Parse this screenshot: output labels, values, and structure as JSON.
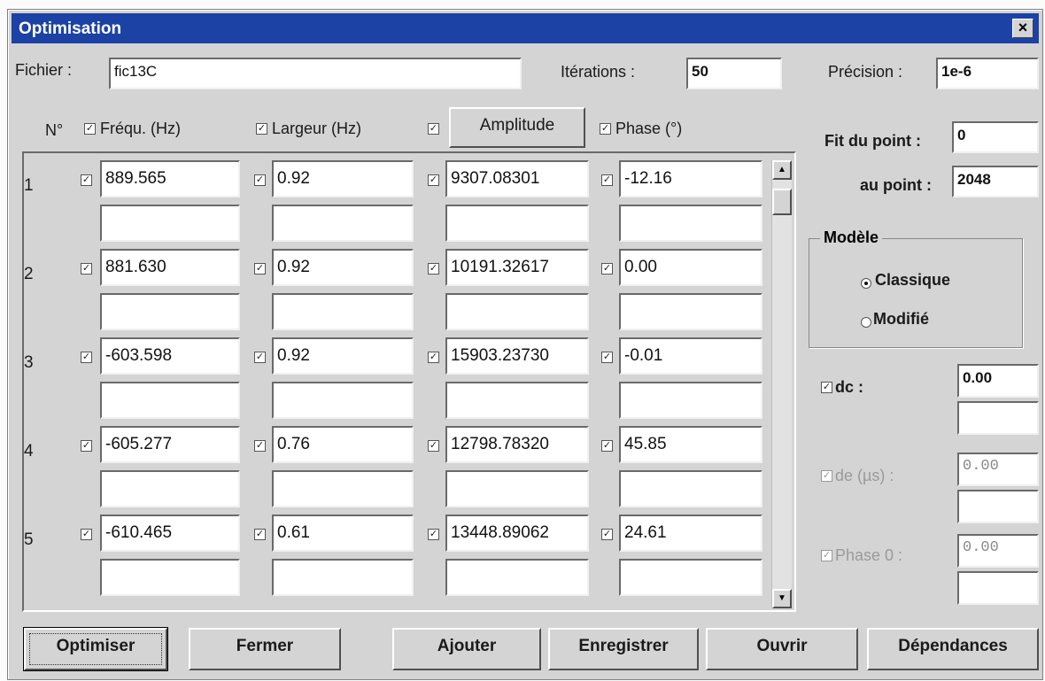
{
  "window": {
    "title": "Optimisation",
    "close_glyph": "×"
  },
  "fichier": {
    "label": "Fichier :",
    "value": "fic13C"
  },
  "iterations": {
    "label": "Itérations :",
    "value": "50"
  },
  "precision": {
    "label": "Précision :",
    "value": "1e-6"
  },
  "columns": {
    "num": "N°",
    "freq": "Fréqu. (Hz)",
    "largeur": "Largeur (Hz)",
    "amplitude_button": "Amplitude",
    "phase": "Phase (°)"
  },
  "check_glyph": "✓",
  "rows": [
    {
      "n": "1",
      "freq": "889.565",
      "largeur": "0.92",
      "amplitude": "9307.08301",
      "phase": "-12.16"
    },
    {
      "n": "2",
      "freq": "881.630",
      "largeur": "0.92",
      "amplitude": "10191.32617",
      "phase": "0.00"
    },
    {
      "n": "3",
      "freq": "-603.598",
      "largeur": "0.92",
      "amplitude": "15903.23730",
      "phase": "-0.01"
    },
    {
      "n": "4",
      "freq": "-605.277",
      "largeur": "0.76",
      "amplitude": "12798.78320",
      "phase": "45.85"
    },
    {
      "n": "5",
      "freq": "-610.465",
      "largeur": "0.61",
      "amplitude": "13448.89062",
      "phase": "24.61"
    }
  ],
  "fit": {
    "from_label": "Fit du point :",
    "from_value": "0",
    "to_label": "au point :",
    "to_value": "2048"
  },
  "modele": {
    "legend": "Modèle",
    "option1": "Classique",
    "option2": "Modifié",
    "selected": "Classique"
  },
  "dc": {
    "label": "dc :",
    "value": "0.00"
  },
  "de": {
    "label": "de (µs) :",
    "value": "0.00"
  },
  "phase0": {
    "label": "Phase 0 :",
    "value": "0.00"
  },
  "buttons": {
    "optimiser": "Optimiser",
    "fermer": "Fermer",
    "ajouter": "Ajouter",
    "enregistrer": "Enregistrer",
    "ouvrir": "Ouvrir",
    "dependances": "Dépendances"
  }
}
